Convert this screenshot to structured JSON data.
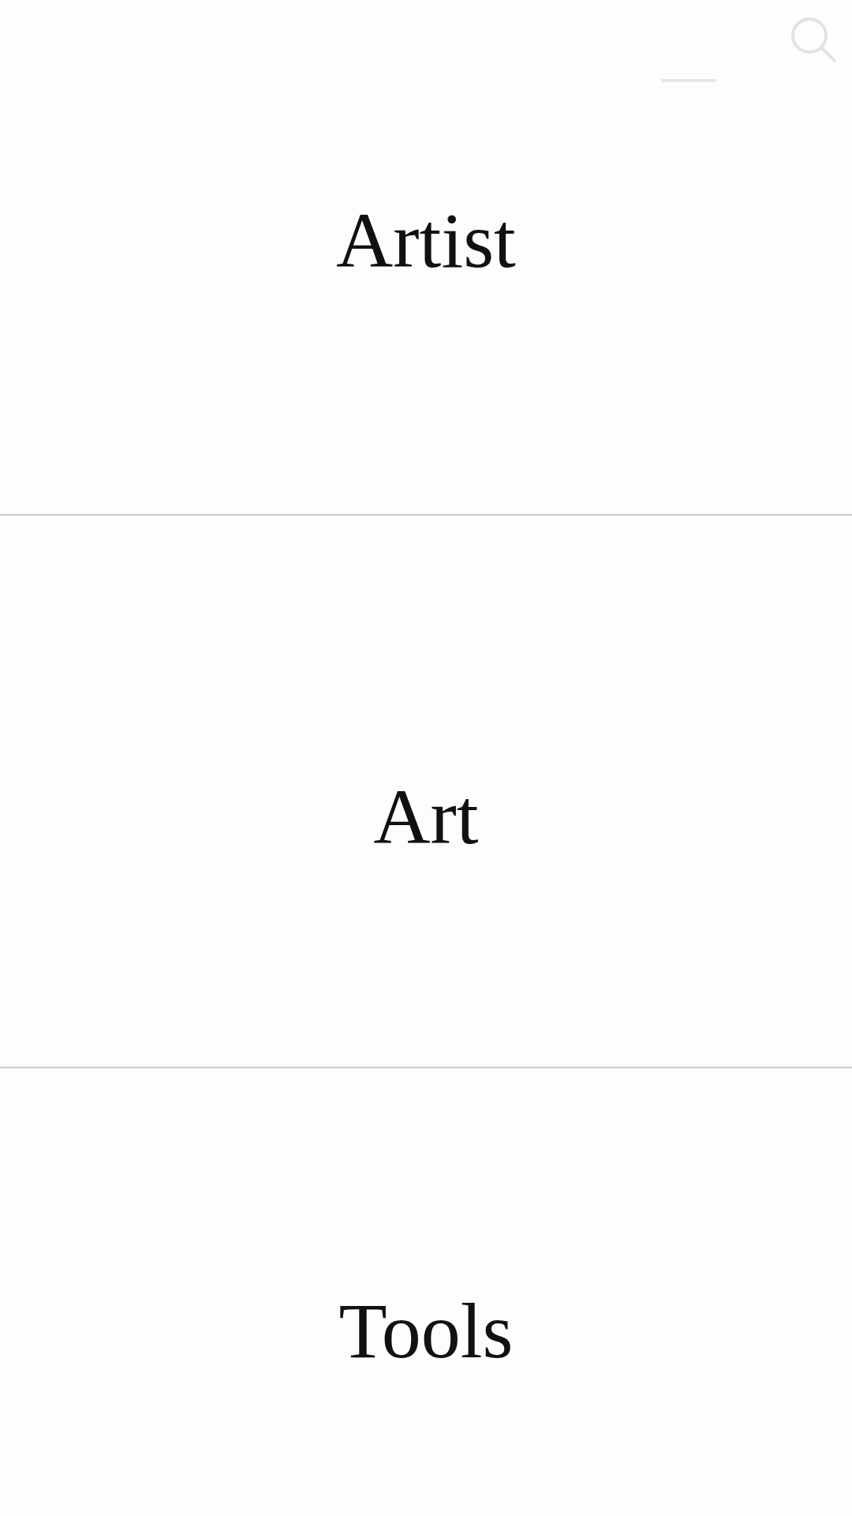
{
  "categories": [
    {
      "label": "Artist"
    },
    {
      "label": "Art"
    },
    {
      "label": "Tools"
    }
  ]
}
